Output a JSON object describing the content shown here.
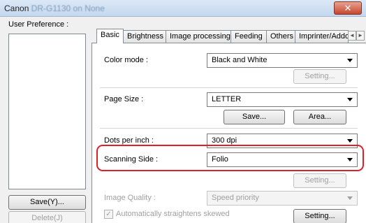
{
  "window": {
    "title_prefix": "Canon",
    "title_muted": "DR-G1130 on None",
    "close_glyph": "✕"
  },
  "sidebar": {
    "label": "User Preference :",
    "save_label": "Save(Y)...",
    "delete_label": "Delete(J)"
  },
  "tabs": [
    {
      "label": "Basic"
    },
    {
      "label": "Brightness"
    },
    {
      "label": "Image processing"
    },
    {
      "label": "Feeding"
    },
    {
      "label": "Others"
    },
    {
      "label": "Imprinter/Addo"
    }
  ],
  "tab_scroll": {
    "left": "◄",
    "right": "►"
  },
  "basic": {
    "color_mode": {
      "label": "Color mode :",
      "value": "Black and White",
      "setting_label": "Setting..."
    },
    "page_size": {
      "label": "Page Size :",
      "value": "LETTER",
      "save_label": "Save...",
      "area_label": "Area..."
    },
    "dpi": {
      "label": "Dots per inch :",
      "value": "300 dpi"
    },
    "scanning_side": {
      "label": "Scanning Side :",
      "value": "Folio",
      "setting_label": "Setting..."
    },
    "image_quality": {
      "label": "Image Quality :",
      "value": "Speed priority"
    },
    "straighten": {
      "label": "Automatically straightens skewed",
      "checked": true,
      "check_glyph": "✓",
      "setting_label": "Setting..."
    }
  },
  "colors": {
    "highlight": "#e01f26"
  }
}
